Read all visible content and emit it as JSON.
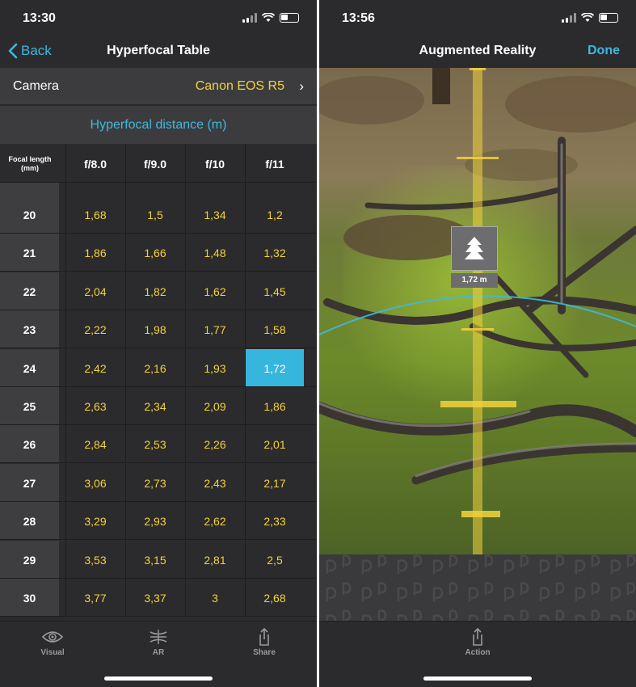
{
  "left": {
    "status": {
      "time": "13:30"
    },
    "nav": {
      "back_label": "Back",
      "title": "Hyperfocal Table"
    },
    "camera": {
      "label": "Camera",
      "value": "Canon EOS R5"
    },
    "table_title": "Hyperfocal distance (m)",
    "columns": {
      "focal_length_header": "Focal length (mm)",
      "apertures": [
        "f/8.0",
        "f/9.0",
        "f/10",
        "f/11"
      ]
    },
    "rows": [
      {
        "focal": "20",
        "values": [
          "1,68",
          "1,5",
          "1,34",
          "1,2"
        ]
      },
      {
        "focal": "21",
        "values": [
          "1,86",
          "1,66",
          "1,48",
          "1,32"
        ]
      },
      {
        "focal": "22",
        "values": [
          "2,04",
          "1,82",
          "1,62",
          "1,45"
        ]
      },
      {
        "focal": "23",
        "values": [
          "2,22",
          "1,98",
          "1,77",
          "1,58"
        ]
      },
      {
        "focal": "24",
        "values": [
          "2,42",
          "2,16",
          "1,93",
          "1,72"
        ]
      },
      {
        "focal": "25",
        "values": [
          "2,63",
          "2,34",
          "2,09",
          "1,86"
        ]
      },
      {
        "focal": "26",
        "values": [
          "2,84",
          "2,53",
          "2,26",
          "2,01"
        ]
      },
      {
        "focal": "27",
        "values": [
          "3,06",
          "2,73",
          "2,43",
          "2,17"
        ]
      },
      {
        "focal": "28",
        "values": [
          "3,29",
          "2,93",
          "2,62",
          "2,33"
        ]
      },
      {
        "focal": "29",
        "values": [
          "3,53",
          "3,15",
          "2,81",
          "2,5"
        ]
      },
      {
        "focal": "30",
        "values": [
          "3,77",
          "3,37",
          "3",
          "2,68"
        ]
      }
    ],
    "selected": {
      "focal": "24",
      "aperture": "f/11"
    },
    "tabs": [
      {
        "label": "Visual",
        "icon": "eye-icon"
      },
      {
        "label": "AR",
        "icon": "ar-waves-icon"
      },
      {
        "label": "Share",
        "icon": "share-icon"
      }
    ]
  },
  "right": {
    "status": {
      "time": "13:56"
    },
    "nav": {
      "title": "Augmented Reality",
      "done_label": "Done"
    },
    "marker": {
      "label": "1,72 m",
      "icon": "tree-icon"
    },
    "tabs": [
      {
        "label": "Action",
        "icon": "share-icon"
      }
    ]
  },
  "colors": {
    "accent": "#3fb8de",
    "value_yellow": "#f2d23c",
    "selected_cell": "#36b6dc"
  }
}
